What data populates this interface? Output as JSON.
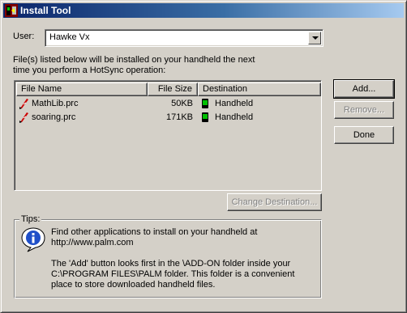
{
  "window": {
    "title": "Install Tool"
  },
  "user": {
    "label": "User:",
    "selected": "Hawke Vx"
  },
  "description": {
    "line1": "File(s) listed below will be installed on your handheld the next",
    "line2": "time you perform a HotSync operation:"
  },
  "list": {
    "columns": [
      "File Name",
      "File Size",
      "Destination"
    ],
    "rows": [
      {
        "name": "MathLib.prc",
        "size": "50KB",
        "destination": "Handheld"
      },
      {
        "name": "soaring.prc",
        "size": "171KB",
        "destination": "Handheld"
      }
    ]
  },
  "buttons": {
    "add": "Add...",
    "remove": "Remove...",
    "done": "Done",
    "change_destination": "Change Destination..."
  },
  "tips": {
    "title": "Tips:",
    "p1_line1": "Find other applications to install on your handheld at",
    "p1_line2": "http://www.palm.com",
    "p2_line1": "The 'Add' button looks first in the \\ADD-ON folder inside your",
    "p2_line2": "C:\\PROGRAM FILES\\PALM folder. This folder is a convenient",
    "p2_line3": "place to store downloaded handheld files."
  },
  "colors": {
    "title_bar_start": "#0a246a",
    "title_bar_end": "#a6caf0",
    "face": "#d4d0c8",
    "disabled_text": "#808080",
    "handheld_icon": "#00c000",
    "file_icon": "#cc0000"
  },
  "icons": {
    "title": "palm-install-icon",
    "file": "prc-file-icon",
    "destination": "handheld-icon",
    "tips": "info-icon",
    "dropdown": "chevron-down-icon"
  }
}
